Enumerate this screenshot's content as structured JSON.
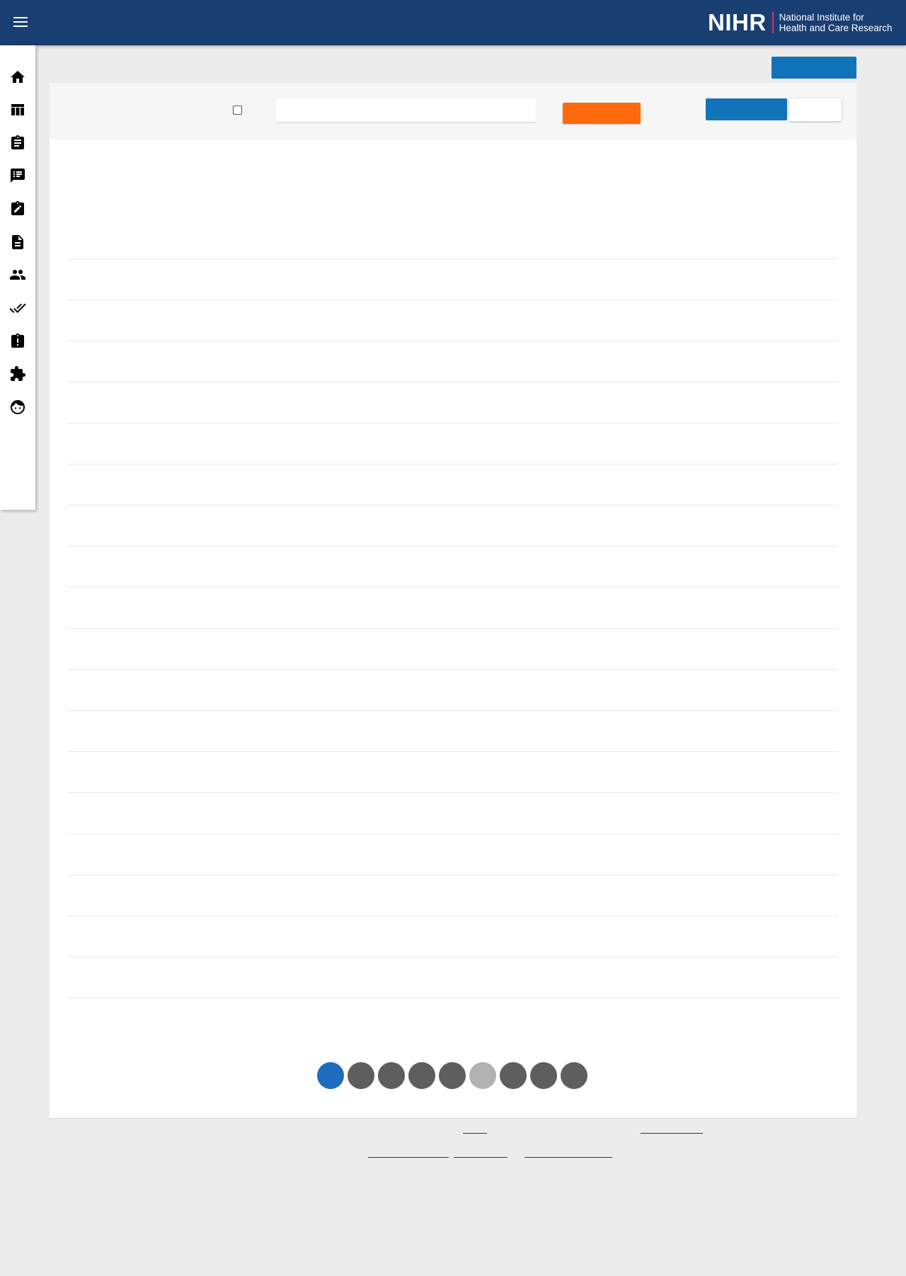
{
  "header": {
    "menu_icon": "hamburger-menu-icon",
    "logo": {
      "mark": "NIHR",
      "line1": "National Institute for",
      "line2": "Health and Care Research"
    },
    "colors": {
      "bar": "#193e72",
      "logo_separator": "#d9336b"
    }
  },
  "sidebar": {
    "items": [
      {
        "icon": "home-icon"
      },
      {
        "icon": "table-icon"
      },
      {
        "icon": "clipboard-icon"
      },
      {
        "icon": "feedback-list-icon"
      },
      {
        "icon": "clipboard-edit-icon"
      },
      {
        "icon": "document-icon"
      },
      {
        "icon": "people-icon"
      },
      {
        "icon": "double-check-icon"
      },
      {
        "icon": "clipboard-alert-icon"
      },
      {
        "icon": "puzzle-icon"
      },
      {
        "icon": "face-icon"
      }
    ]
  },
  "toolbar": {
    "search_placeholder": "",
    "search_value": "",
    "checkbox_checked": false
  },
  "pagination": {
    "pages": 9,
    "active_index": 0,
    "disabled_index": 5
  },
  "colors": {
    "primary_button": "#1173b9",
    "accent_button": "#ff6a0d",
    "page_active": "#1c6dbd",
    "page_inactive": "#5e5e5e",
    "page_disabled": "#b1b1b1"
  }
}
